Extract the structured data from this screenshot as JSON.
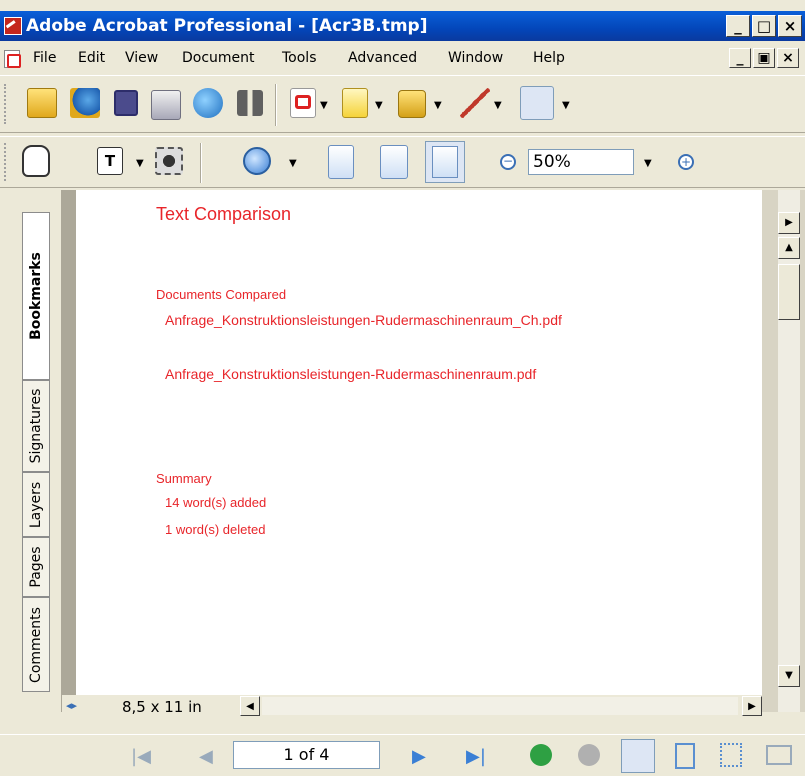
{
  "window": {
    "title": "Adobe Acrobat Professional - [Acr3B.tmp]",
    "minimize": "_",
    "maximize": "□",
    "close": "×"
  },
  "menubar": {
    "items": [
      "File",
      "Edit",
      "View",
      "Document",
      "Tools",
      "Advanced",
      "Window",
      "Help"
    ],
    "mdi_min": "_",
    "mdi_restore": "▣",
    "mdi_close": "×"
  },
  "toolbar": {
    "zoom_value": "50%"
  },
  "nav_tabs": [
    "Bookmarks",
    "Signatures",
    "Layers",
    "Pages",
    "Comments"
  ],
  "document": {
    "heading": "Text Comparison",
    "compared_label": "Documents Compared",
    "file1": "Anfrage_Konstruktionsleistungen-Rudermaschinenraum_Ch.pdf",
    "file2": "Anfrage_Konstruktionsleistungen-Rudermaschinenraum.pdf",
    "summary_label": "Summary",
    "added": "14 word(s) added",
    "deleted": "1 word(s) deleted"
  },
  "page_size": "8,5 x 11 in",
  "status": {
    "page_indicator": "1 of 4"
  },
  "colors": {
    "title_bar": "#0A5FD8",
    "doc_text": "#E8252A",
    "chrome": "#ECE9D8"
  }
}
